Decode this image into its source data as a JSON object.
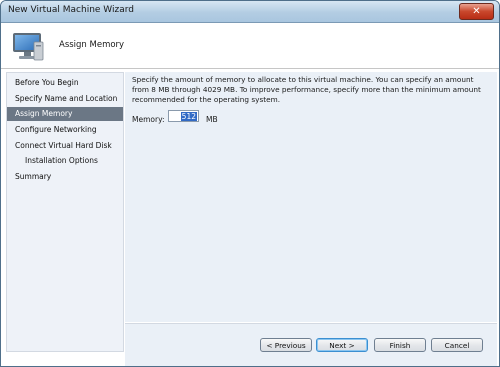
{
  "window": {
    "title": "New Virtual Machine Wizard"
  },
  "header": {
    "title": "Assign Memory",
    "icon": "computer-monitor-icon"
  },
  "nav": {
    "items": [
      {
        "label": "Before You Begin"
      },
      {
        "label": "Specify Name and Location"
      },
      {
        "label": "Assign Memory",
        "active": true
      },
      {
        "label": "Configure Networking"
      },
      {
        "label": "Connect Virtual Hard Disk"
      },
      {
        "label": "Installation Options",
        "sub": true
      },
      {
        "label": "Summary"
      }
    ]
  },
  "content": {
    "description": "Specify the amount of memory to allocate to this virtual machine. You can specify an amount from 8 MB through 4029 MB. To improve performance, specify more than the minimum amount recommended for the operating system.",
    "memory_label": "Memory:",
    "memory_value": "512",
    "memory_unit": "MB"
  },
  "buttons": {
    "previous": "< Previous",
    "next": "Next >",
    "finish": "Finish",
    "cancel": "Cancel"
  },
  "colors": {
    "selected_nav": "#6b7785",
    "content_bg": "#eaf0f7"
  }
}
